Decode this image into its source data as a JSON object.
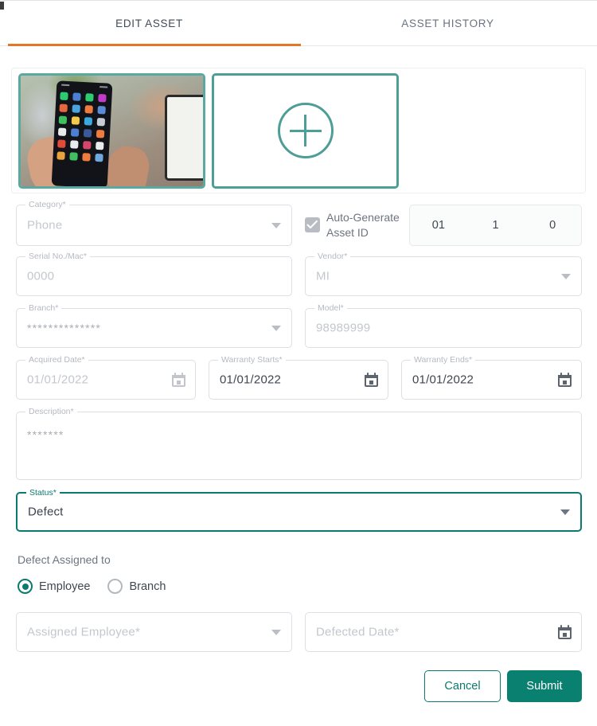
{
  "tabs": [
    {
      "label": "EDIT ASSET",
      "active": true
    },
    {
      "label": "ASSET HISTORY",
      "active": false
    }
  ],
  "colors": {
    "accent_orange": "#e2762b",
    "accent_teal": "#0c7a6e",
    "thumb_border_teal": "#5aa9a0",
    "submit_bg": "#0a8070"
  },
  "media": {
    "existing_thumbnail_alt": "phone-in-hand-photo",
    "add_button_icon": "plus-circle-icon"
  },
  "form": {
    "category": {
      "label": "Category*",
      "value": "Phone",
      "icon": "chevron-down-icon"
    },
    "auto_generate": {
      "label": "Auto-Generate Asset ID",
      "checked": true,
      "segments": [
        "01",
        "1",
        "0"
      ]
    },
    "serial": {
      "label": "Serial No./Mac*",
      "value": "0000"
    },
    "vendor": {
      "label": "Vendor*",
      "value": "MI",
      "icon": "chevron-down-icon"
    },
    "branch": {
      "label": "Branch*",
      "value": "**************",
      "icon": "chevron-down-icon"
    },
    "model": {
      "label": "Model*",
      "value": "98989999"
    },
    "acquired_date": {
      "label": "Acquired Date*",
      "value": "01/01/2022",
      "icon": "calendar-icon"
    },
    "warranty_starts": {
      "label": "Warranty Starts*",
      "value": "01/01/2022",
      "icon": "calendar-icon"
    },
    "warranty_ends": {
      "label": "Warranty Ends*",
      "value": "01/01/2022",
      "icon": "calendar-icon"
    },
    "description": {
      "label": "Description*",
      "value": "*******"
    },
    "status": {
      "label": "Status*",
      "value": "Defect",
      "icon": "chevron-down-icon"
    }
  },
  "defect": {
    "section_label": "Defect Assigned to",
    "options": [
      {
        "label": "Employee",
        "selected": true
      },
      {
        "label": "Branch",
        "selected": false
      }
    ],
    "assigned_employee": {
      "placeholder": "Assigned Employee*",
      "icon": "chevron-down-icon"
    },
    "defected_date": {
      "placeholder": "Defected Date*",
      "icon": "calendar-icon"
    }
  },
  "actions": {
    "cancel": "Cancel",
    "submit": "Submit"
  }
}
